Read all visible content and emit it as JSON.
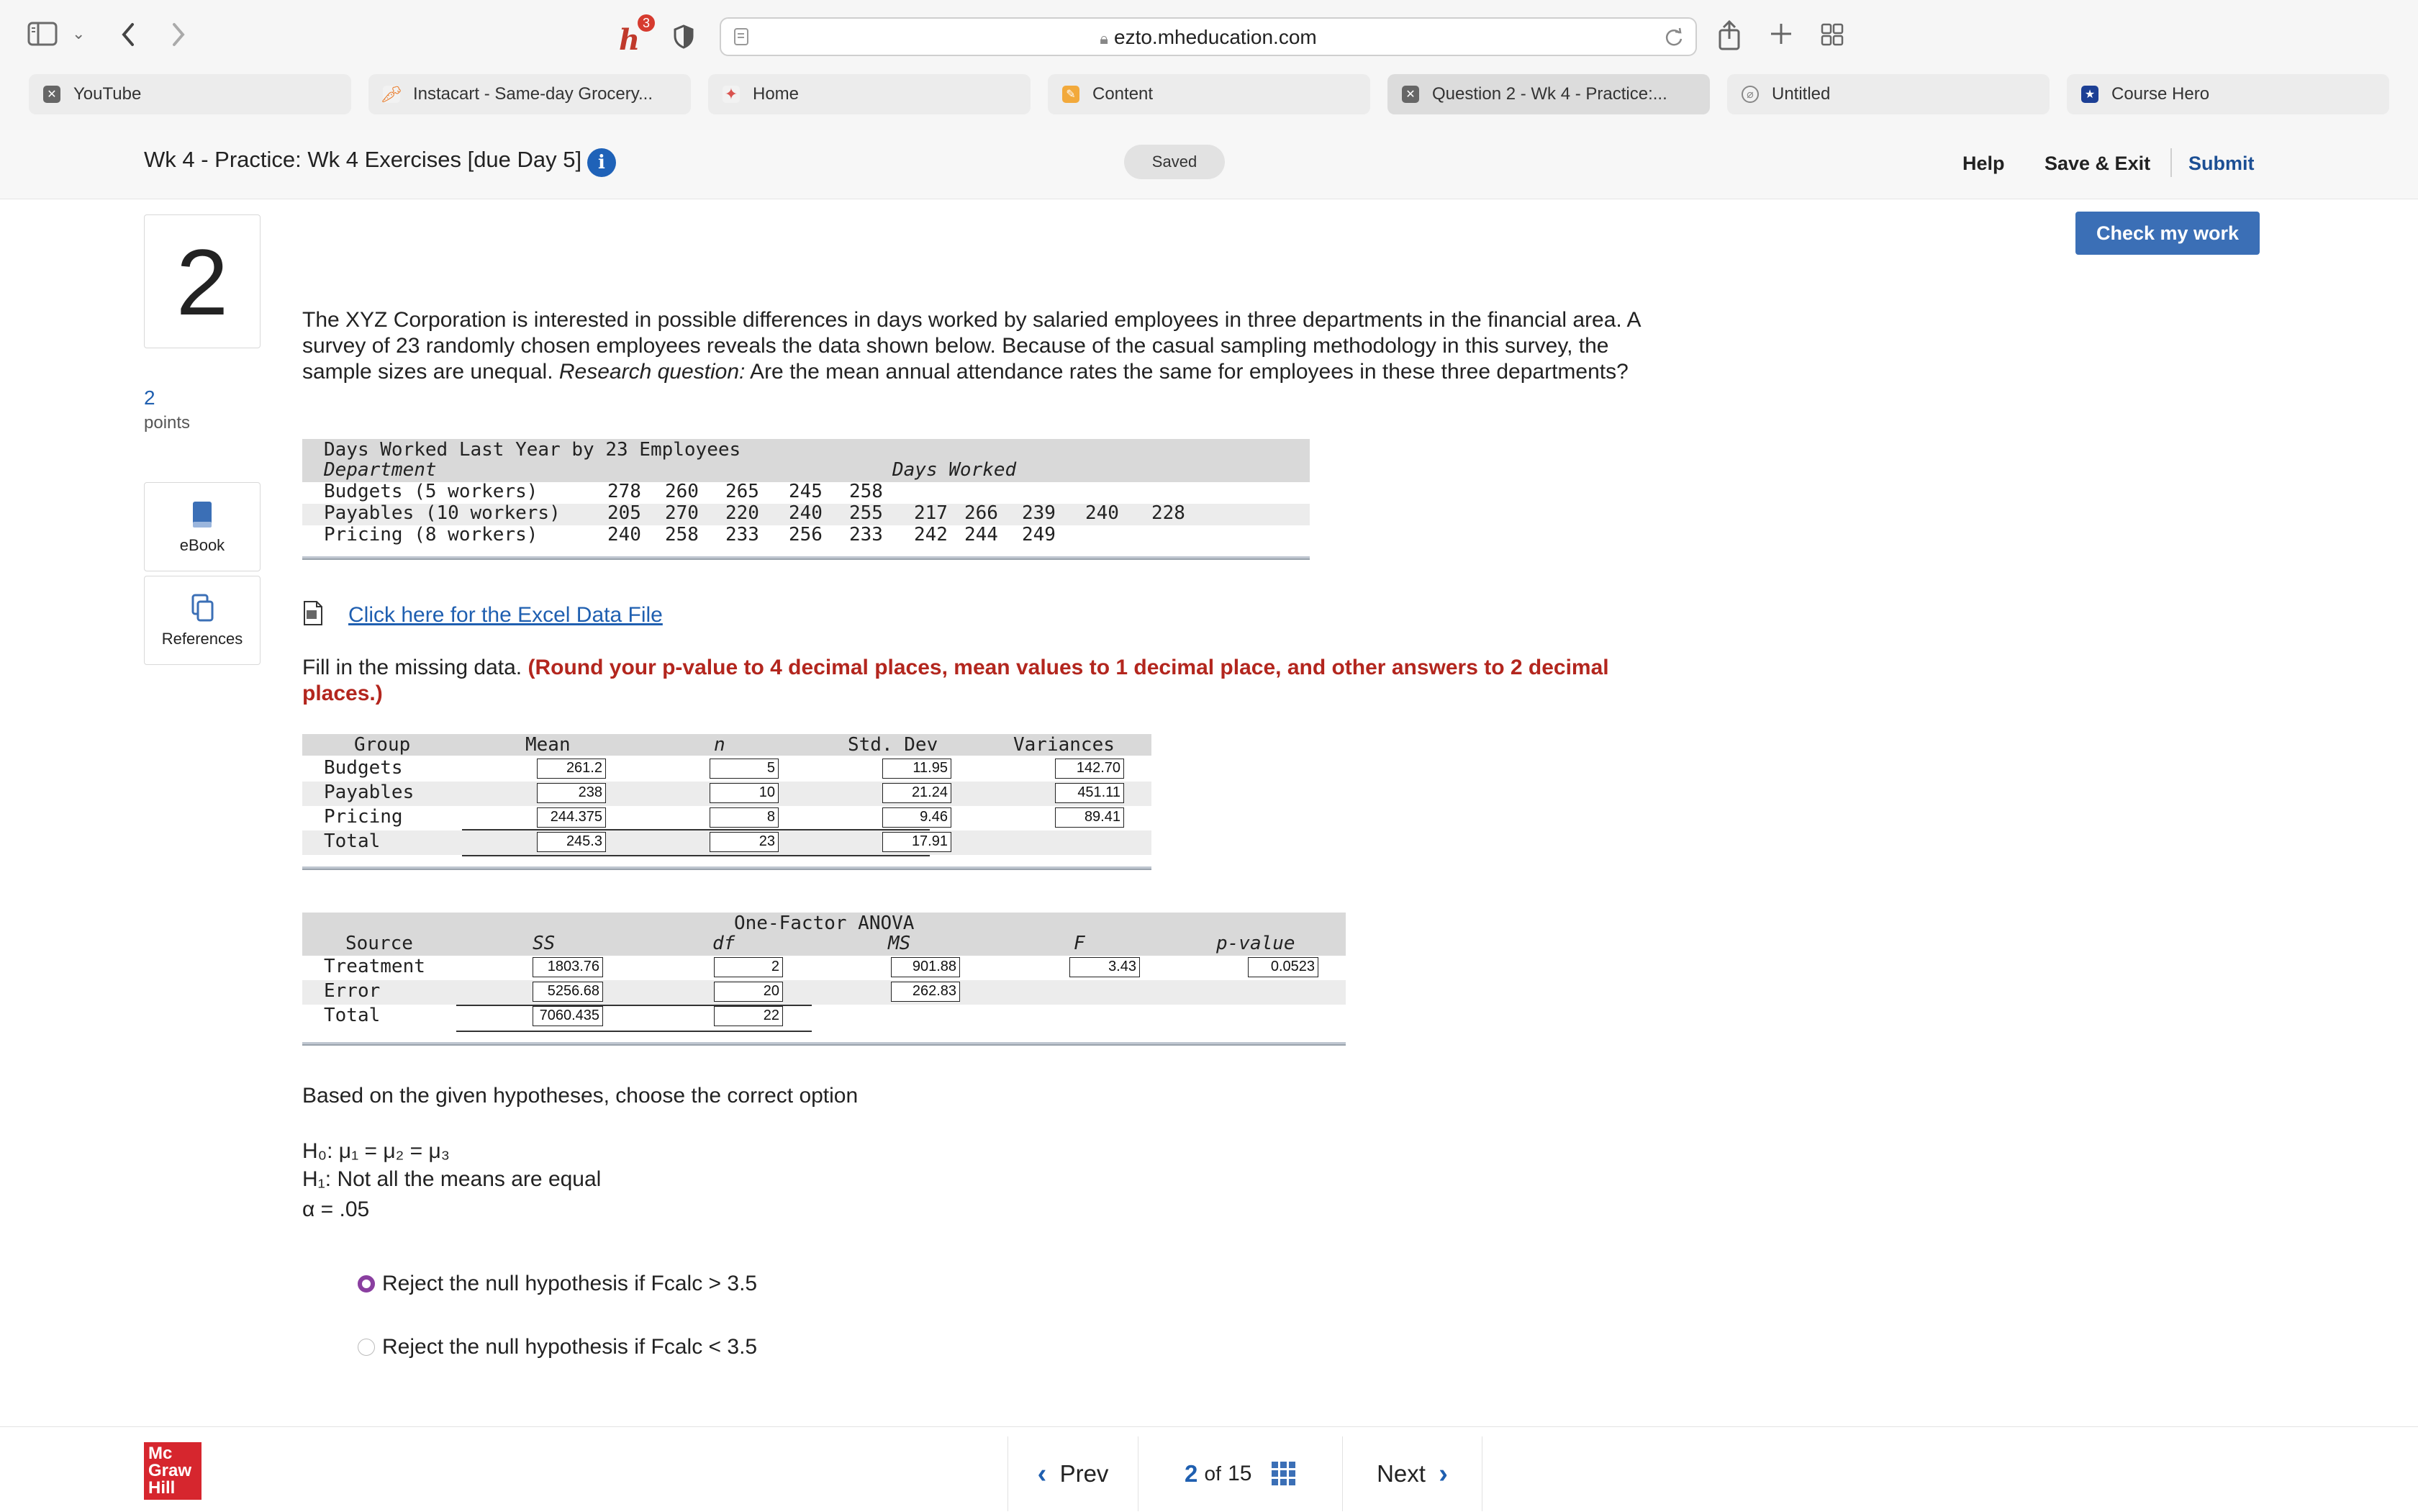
{
  "browser": {
    "url": "ezto.mheducation.com",
    "notification_count": "3",
    "tabs": [
      {
        "label": "YouTube",
        "icon": "youtube-icon",
        "active": false
      },
      {
        "label": "Instacart - Same-day Grocery...",
        "icon": "carrot-icon",
        "active": false
      },
      {
        "label": "Home",
        "icon": "home-icon",
        "active": false
      },
      {
        "label": "Content",
        "icon": "content-icon",
        "active": false
      },
      {
        "label": "Question 2 - Wk 4 - Practice:...",
        "icon": "connect-icon",
        "active": true
      },
      {
        "label": "Untitled",
        "icon": "compass-icon",
        "active": false
      },
      {
        "label": "Course Hero",
        "icon": "coursehero-icon",
        "active": false
      }
    ]
  },
  "header": {
    "assignment_title": "Wk 4 - Practice: Wk 4 Exercises [due Day 5]",
    "saved_label": "Saved",
    "help_label": "Help",
    "save_exit_label": "Save & Exit",
    "submit_label": "Submit",
    "check_work_label": "Check my work"
  },
  "sidebar": {
    "question_number": "2",
    "points_value": "2",
    "points_label": "points",
    "ebook_label": "eBook",
    "references_label": "References"
  },
  "question": {
    "text_part1": "The XYZ Corporation is interested in possible differences in days worked by salaried employees in three departments in the financial area. A survey of 23 randomly chosen employees reveals the data shown below. Because of the casual sampling methodology in this survey, the sample sizes are unequal. ",
    "text_italic": "Research question:",
    "text_part2": " Are the mean annual attendance rates the same for employees in these three departments?",
    "data_table": {
      "title": "Days Worked Last Year by 23 Employees",
      "col_department": "Department",
      "col_days": "Days Worked",
      "rows": [
        {
          "dept": "Budgets (5 workers)",
          "values": [
            "278",
            "260",
            "265",
            "245",
            "258"
          ]
        },
        {
          "dept": "Payables (10 workers)",
          "values": [
            "205",
            "270",
            "220",
            "240",
            "255",
            "217",
            "266",
            "239",
            "240",
            "228"
          ]
        },
        {
          "dept": "Pricing (8 workers)",
          "values": [
            "240",
            "258",
            "233",
            "256",
            "233",
            "242",
            "244",
            "249"
          ]
        }
      ]
    },
    "excel_link": "Click here for the Excel Data File",
    "fill_intro": "Fill in the missing data. ",
    "fill_instruction": "(Round your p-value to 4 decimal places, mean values to 1 decimal place, and other answers to 2 decimal places.)",
    "stats_table": {
      "headers": [
        "Group",
        "Mean",
        "n",
        "Std. Dev",
        "Variances"
      ],
      "rows": [
        {
          "group": "Budgets",
          "mean": "261.2",
          "n": "5",
          "sd": "11.95",
          "var": "142.70"
        },
        {
          "group": "Payables",
          "mean": "238",
          "n": "10",
          "sd": "21.24",
          "var": "451.11"
        },
        {
          "group": "Pricing",
          "mean": "244.375",
          "n": "8",
          "sd": "9.46",
          "var": "89.41"
        },
        {
          "group": "Total",
          "mean": "245.3",
          "n": "23",
          "sd": "17.91",
          "var": ""
        }
      ]
    },
    "anova_table": {
      "title": "One-Factor ANOVA",
      "headers": [
        "Source",
        "SS",
        "df",
        "MS",
        "F",
        "p-value"
      ],
      "rows": [
        {
          "source": "Treatment",
          "ss": "1803.76",
          "df": "2",
          "ms": "901.88",
          "f": "3.43",
          "p": "0.0523"
        },
        {
          "source": "Error",
          "ss": "5256.68",
          "df": "20",
          "ms": "262.83",
          "f": "",
          "p": ""
        },
        {
          "source": "Total",
          "ss": "7060.435",
          "df": "22",
          "ms": "",
          "f": "",
          "p": ""
        }
      ]
    },
    "hyp_lead": "Based on the given hypotheses, choose the correct option",
    "h0": "H₀: μ₁ = μ₂ = μ₃",
    "h1": "H₁: Not all the means are equal",
    "alpha": "α = .05",
    "options": [
      {
        "label": "Reject the null hypothesis if Fcalc > 3.5",
        "selected": true
      },
      {
        "label": "Reject the null hypothesis if Fcalc < 3.5",
        "selected": false
      }
    ]
  },
  "footer": {
    "logo_text": "Mc Graw Hill",
    "prev_label": "Prev",
    "current_page": "2",
    "of_label": "of",
    "total_pages": "15",
    "next_label": "Next"
  },
  "colors": {
    "accent_blue": "#3b6fb6",
    "link_blue": "#1f5fb0",
    "instruction_red": "#b3261e",
    "radio_selected": "#8a3fa0"
  }
}
